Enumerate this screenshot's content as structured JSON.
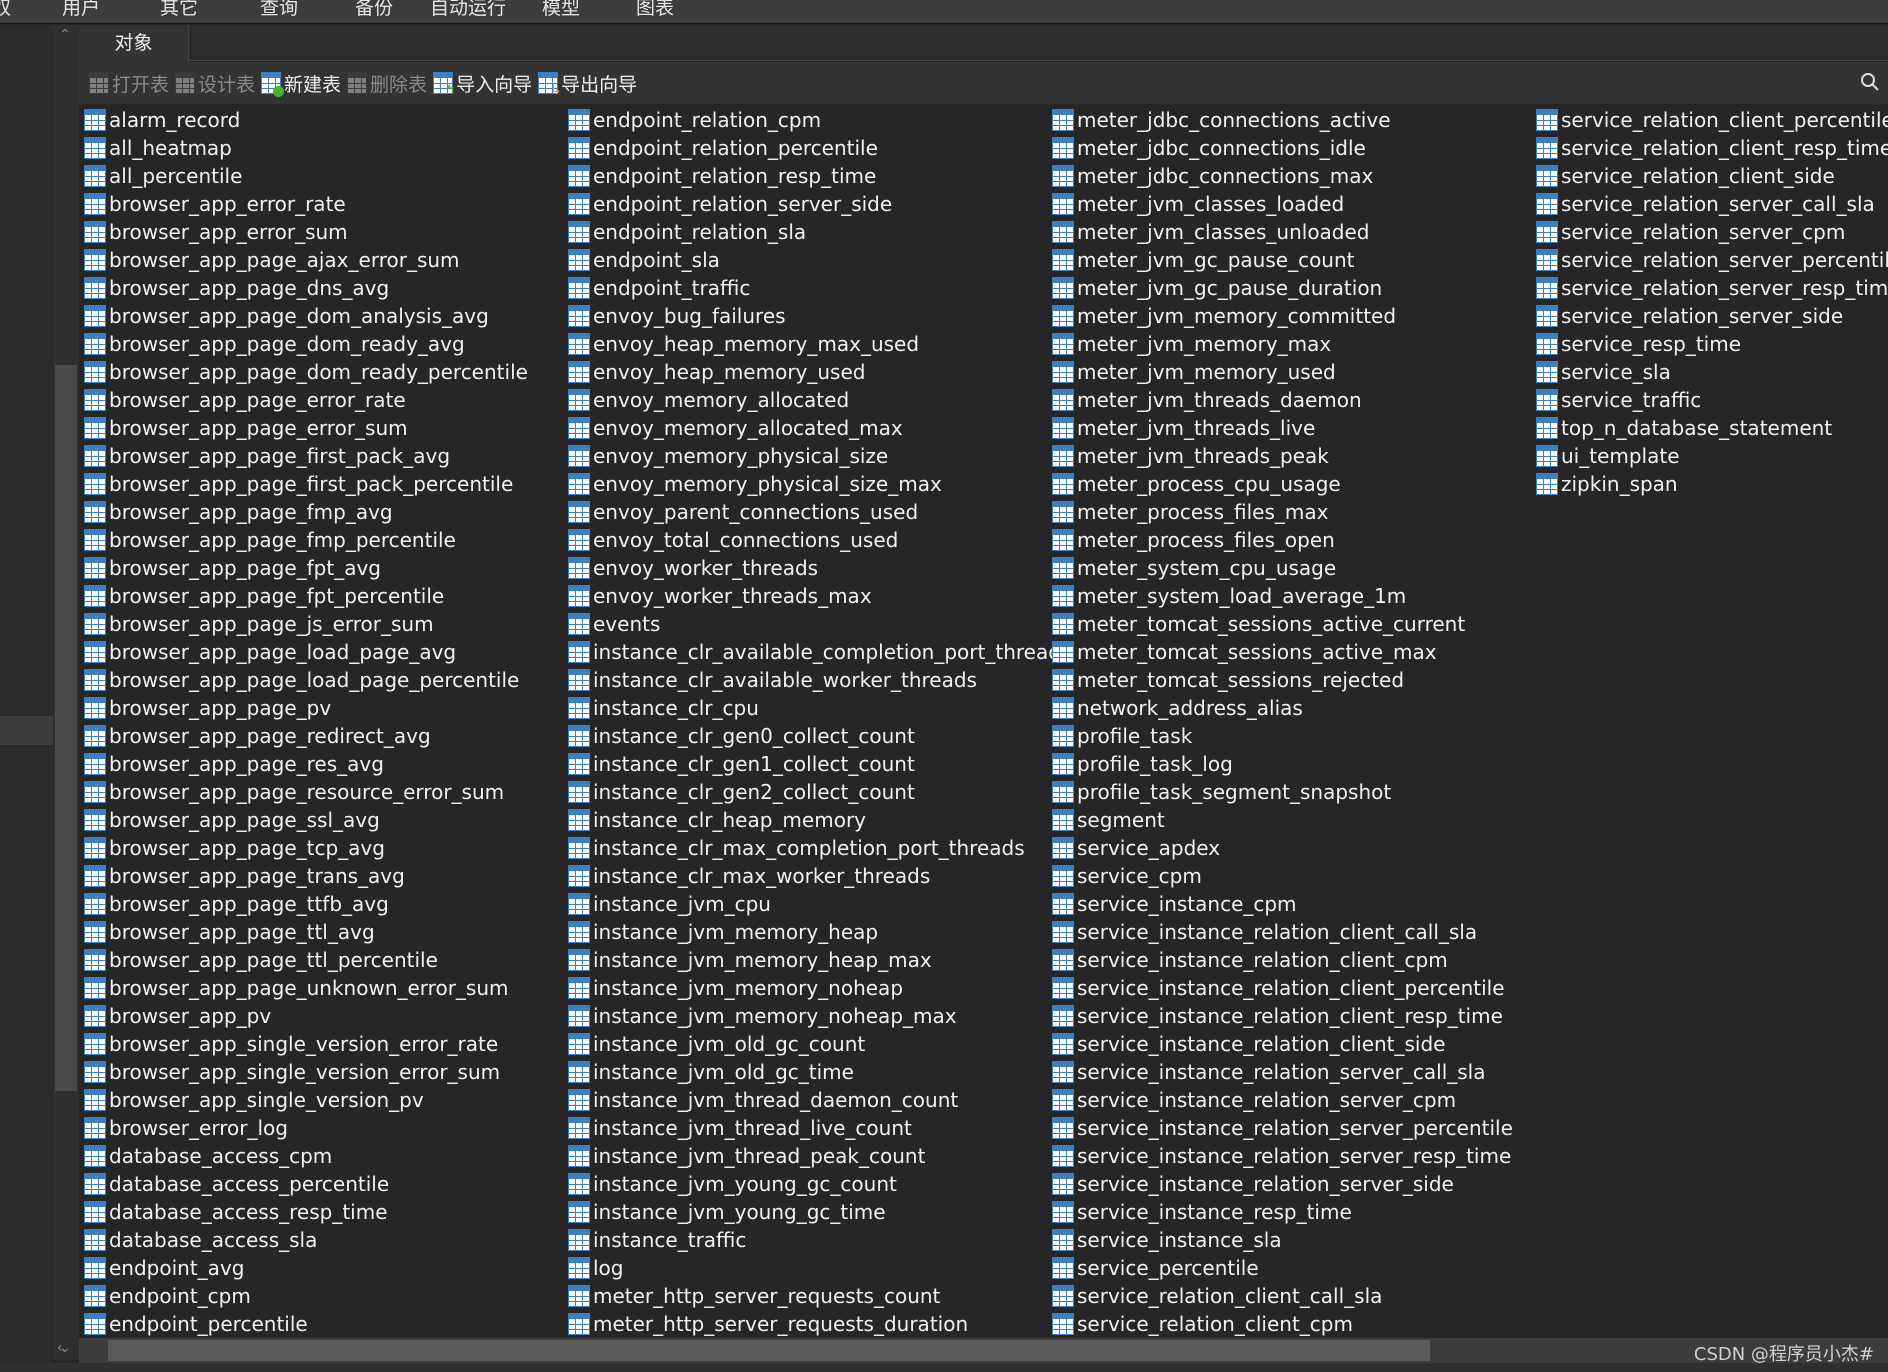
{
  "menu": [
    "奴",
    "用户",
    "其它",
    "查询",
    "备份",
    "自动运行",
    "模型",
    "图表"
  ],
  "tab": {
    "label": "对象"
  },
  "toolbar": {
    "open_table": "打开表",
    "design_table": "设计表",
    "new_table": "新建表",
    "delete_table": "删除表",
    "import_wizard": "导入向导",
    "export_wizard": "导出向导"
  },
  "tables": [
    "alarm_record",
    "all_heatmap",
    "all_percentile",
    "browser_app_error_rate",
    "browser_app_error_sum",
    "browser_app_page_ajax_error_sum",
    "browser_app_page_dns_avg",
    "browser_app_page_dom_analysis_avg",
    "browser_app_page_dom_ready_avg",
    "browser_app_page_dom_ready_percentile",
    "browser_app_page_error_rate",
    "browser_app_page_error_sum",
    "browser_app_page_first_pack_avg",
    "browser_app_page_first_pack_percentile",
    "browser_app_page_fmp_avg",
    "browser_app_page_fmp_percentile",
    "browser_app_page_fpt_avg",
    "browser_app_page_fpt_percentile",
    "browser_app_page_js_error_sum",
    "browser_app_page_load_page_avg",
    "browser_app_page_load_page_percentile",
    "browser_app_page_pv",
    "browser_app_page_redirect_avg",
    "browser_app_page_res_avg",
    "browser_app_page_resource_error_sum",
    "browser_app_page_ssl_avg",
    "browser_app_page_tcp_avg",
    "browser_app_page_trans_avg",
    "browser_app_page_ttfb_avg",
    "browser_app_page_ttl_avg",
    "browser_app_page_ttl_percentile",
    "browser_app_page_unknown_error_sum",
    "browser_app_pv",
    "browser_app_single_version_error_rate",
    "browser_app_single_version_error_sum",
    "browser_app_single_version_pv",
    "browser_error_log",
    "database_access_cpm",
    "database_access_percentile",
    "database_access_resp_time",
    "database_access_sla",
    "endpoint_avg",
    "endpoint_cpm",
    "endpoint_percentile",
    "endpoint_relation_cpm",
    "endpoint_relation_percentile",
    "endpoint_relation_resp_time",
    "endpoint_relation_server_side",
    "endpoint_relation_sla",
    "endpoint_sla",
    "endpoint_traffic",
    "envoy_bug_failures",
    "envoy_heap_memory_max_used",
    "envoy_heap_memory_used",
    "envoy_memory_allocated",
    "envoy_memory_allocated_max",
    "envoy_memory_physical_size",
    "envoy_memory_physical_size_max",
    "envoy_parent_connections_used",
    "envoy_total_connections_used",
    "envoy_worker_threads",
    "envoy_worker_threads_max",
    "events",
    "instance_clr_available_completion_port_threads",
    "instance_clr_available_worker_threads",
    "instance_clr_cpu",
    "instance_clr_gen0_collect_count",
    "instance_clr_gen1_collect_count",
    "instance_clr_gen2_collect_count",
    "instance_clr_heap_memory",
    "instance_clr_max_completion_port_threads",
    "instance_clr_max_worker_threads",
    "instance_jvm_cpu",
    "instance_jvm_memory_heap",
    "instance_jvm_memory_heap_max",
    "instance_jvm_memory_noheap",
    "instance_jvm_memory_noheap_max",
    "instance_jvm_old_gc_count",
    "instance_jvm_old_gc_time",
    "instance_jvm_thread_daemon_count",
    "instance_jvm_thread_live_count",
    "instance_jvm_thread_peak_count",
    "instance_jvm_young_gc_count",
    "instance_jvm_young_gc_time",
    "instance_traffic",
    "log",
    "meter_http_server_requests_count",
    "meter_http_server_requests_duration",
    "meter_jdbc_connections_active",
    "meter_jdbc_connections_idle",
    "meter_jdbc_connections_max",
    "meter_jvm_classes_loaded",
    "meter_jvm_classes_unloaded",
    "meter_jvm_gc_pause_count",
    "meter_jvm_gc_pause_duration",
    "meter_jvm_memory_committed",
    "meter_jvm_memory_max",
    "meter_jvm_memory_used",
    "meter_jvm_threads_daemon",
    "meter_jvm_threads_live",
    "meter_jvm_threads_peak",
    "meter_process_cpu_usage",
    "meter_process_files_max",
    "meter_process_files_open",
    "meter_system_cpu_usage",
    "meter_system_load_average_1m",
    "meter_tomcat_sessions_active_current",
    "meter_tomcat_sessions_active_max",
    "meter_tomcat_sessions_rejected",
    "network_address_alias",
    "profile_task",
    "profile_task_log",
    "profile_task_segment_snapshot",
    "segment",
    "service_apdex",
    "service_cpm",
    "service_instance_cpm",
    "service_instance_relation_client_call_sla",
    "service_instance_relation_client_cpm",
    "service_instance_relation_client_percentile",
    "service_instance_relation_client_resp_time",
    "service_instance_relation_client_side",
    "service_instance_relation_server_call_sla",
    "service_instance_relation_server_cpm",
    "service_instance_relation_server_percentile",
    "service_instance_relation_server_resp_time",
    "service_instance_relation_server_side",
    "service_instance_resp_time",
    "service_instance_sla",
    "service_percentile",
    "service_relation_client_call_sla",
    "service_relation_client_cpm",
    "service_relation_client_percentile",
    "service_relation_client_resp_time",
    "service_relation_client_side",
    "service_relation_server_call_sla",
    "service_relation_server_cpm",
    "service_relation_server_percentile",
    "service_relation_server_resp_time",
    "service_relation_server_side",
    "service_resp_time",
    "service_sla",
    "service_traffic",
    "top_n_database_statement",
    "ui_template",
    "zipkin_span"
  ],
  "watermark": "CSDN @程序员小杰#",
  "colors": {
    "table_icon": "#3d7fc4",
    "background": "#262626"
  }
}
